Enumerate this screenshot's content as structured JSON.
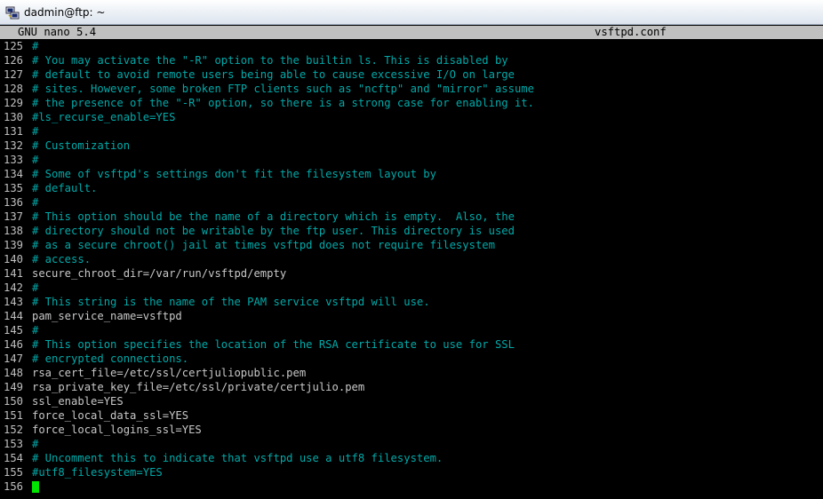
{
  "window": {
    "title": "dadmin@ftp: ~",
    "icon": "putty-icon"
  },
  "nano": {
    "version_label": "GNU nano 5.4",
    "filename": "vsftpd.conf"
  },
  "colors": {
    "comment": "#00a9a9",
    "plain_text": "#c8c8c8",
    "line_number": "#bfbfbf",
    "header_bg": "#c0c0c0",
    "cursor": "#00e600",
    "background": "#000000"
  },
  "lines": [
    {
      "n": "125",
      "text": "#",
      "type": "comment"
    },
    {
      "n": "126",
      "text": "# You may activate the \"-R\" option to the builtin ls. This is disabled by",
      "type": "comment"
    },
    {
      "n": "127",
      "text": "# default to avoid remote users being able to cause excessive I/O on large",
      "type": "comment"
    },
    {
      "n": "128",
      "text": "# sites. However, some broken FTP clients such as \"ncftp\" and \"mirror\" assume",
      "type": "comment"
    },
    {
      "n": "129",
      "text": "# the presence of the \"-R\" option, so there is a strong case for enabling it.",
      "type": "comment"
    },
    {
      "n": "130",
      "text": "#ls_recurse_enable=YES",
      "type": "comment"
    },
    {
      "n": "131",
      "text": "#",
      "type": "comment"
    },
    {
      "n": "132",
      "text": "# Customization",
      "type": "comment"
    },
    {
      "n": "133",
      "text": "#",
      "type": "comment"
    },
    {
      "n": "134",
      "text": "# Some of vsftpd's settings don't fit the filesystem layout by",
      "type": "comment"
    },
    {
      "n": "135",
      "text": "# default.",
      "type": "comment"
    },
    {
      "n": "136",
      "text": "#",
      "type": "comment"
    },
    {
      "n": "137",
      "text": "# This option should be the name of a directory which is empty.  Also, the",
      "type": "comment"
    },
    {
      "n": "138",
      "text": "# directory should not be writable by the ftp user. This directory is used",
      "type": "comment"
    },
    {
      "n": "139",
      "text": "# as a secure chroot() jail at times vsftpd does not require filesystem",
      "type": "comment"
    },
    {
      "n": "140",
      "text": "# access.",
      "type": "comment"
    },
    {
      "n": "141",
      "text": "secure_chroot_dir=/var/run/vsftpd/empty",
      "type": "plain"
    },
    {
      "n": "142",
      "text": "#",
      "type": "comment"
    },
    {
      "n": "143",
      "text": "# This string is the name of the PAM service vsftpd will use.",
      "type": "comment"
    },
    {
      "n": "144",
      "text": "pam_service_name=vsftpd",
      "type": "plain"
    },
    {
      "n": "145",
      "text": "#",
      "type": "comment"
    },
    {
      "n": "146",
      "text": "# This option specifies the location of the RSA certificate to use for SSL",
      "type": "comment"
    },
    {
      "n": "147",
      "text": "# encrypted connections.",
      "type": "comment"
    },
    {
      "n": "148",
      "text": "rsa_cert_file=/etc/ssl/certjuliopublic.pem",
      "type": "plain"
    },
    {
      "n": "149",
      "text": "rsa_private_key_file=/etc/ssl/private/certjulio.pem",
      "type": "plain"
    },
    {
      "n": "150",
      "text": "ssl_enable=YES",
      "type": "plain"
    },
    {
      "n": "151",
      "text": "force_local_data_ssl=YES",
      "type": "plain"
    },
    {
      "n": "152",
      "text": "force_local_logins_ssl=YES",
      "type": "plain"
    },
    {
      "n": "153",
      "text": "#",
      "type": "comment"
    },
    {
      "n": "154",
      "text": "# Uncomment this to indicate that vsftpd use a utf8 filesystem.",
      "type": "comment"
    },
    {
      "n": "155",
      "text": "#utf8_filesystem=YES",
      "type": "comment"
    },
    {
      "n": "156",
      "text": "",
      "type": "plain"
    }
  ]
}
